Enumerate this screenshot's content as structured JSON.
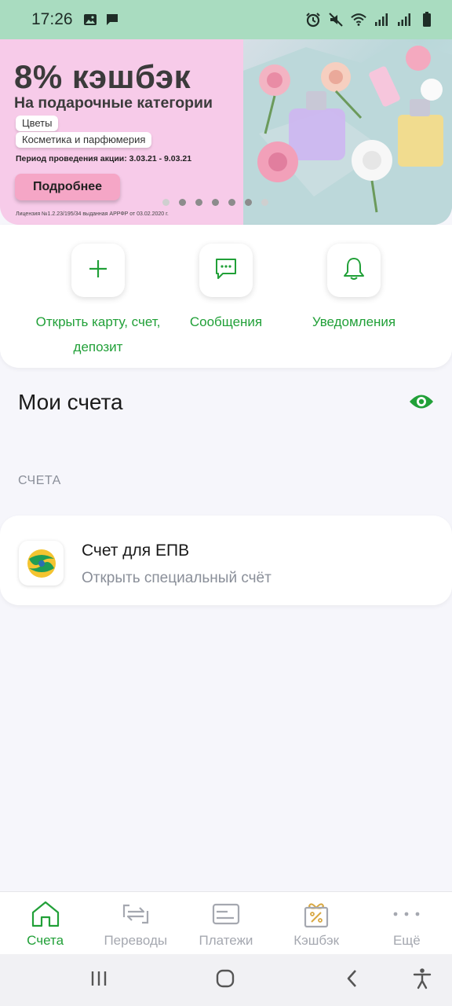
{
  "status_bar": {
    "time": "17:26",
    "left_icons": [
      "image-icon",
      "message-icon"
    ],
    "right_icons": [
      "alarm-icon",
      "mute-icon",
      "wifi-icon",
      "signal-icon",
      "signal-icon",
      "battery-icon"
    ]
  },
  "banner": {
    "title": "8% кэшбэк",
    "subtitle": "На подарочные категории",
    "tags": [
      "Цветы",
      "Косметика и парфюмерия"
    ],
    "period": "Период проведения акции: 3.03.21 - 9.03.21",
    "button_label": "Подробнее",
    "license": "Лицензия №1.2.23/195/34 выданная АРРФР от 03.02.2020 г.",
    "page_count": 7,
    "active_page": 1
  },
  "quick_actions": [
    {
      "label": "Открыть карту, счет, депозит",
      "icon": "plus-icon"
    },
    {
      "label": "Сообщения",
      "icon": "chat-icon"
    },
    {
      "label": "Уведомления",
      "icon": "bell-icon"
    }
  ],
  "accounts": {
    "title": "Мои счета",
    "section_label": "СЧЕТА",
    "items": [
      {
        "title": "Счет для ЕПВ",
        "subtitle": "Открыть специальный счёт"
      }
    ]
  },
  "bottom_nav": [
    {
      "label": "Счета",
      "icon": "home-icon",
      "active": true
    },
    {
      "label": "Переводы",
      "icon": "transfer-icon",
      "active": false
    },
    {
      "label": "Платежи",
      "icon": "card-icon",
      "active": false
    },
    {
      "label": "Кэшбэк",
      "icon": "gift-icon",
      "active": false
    },
    {
      "label": "Ещё",
      "icon": "more-icon",
      "active": false
    }
  ],
  "colors": {
    "accent": "#21a038",
    "status_bar": "#a9dcc0",
    "banner_bg": "#f7cbe9",
    "button_pink": "#f5a6c6",
    "muted_text": "#8a8f99"
  }
}
